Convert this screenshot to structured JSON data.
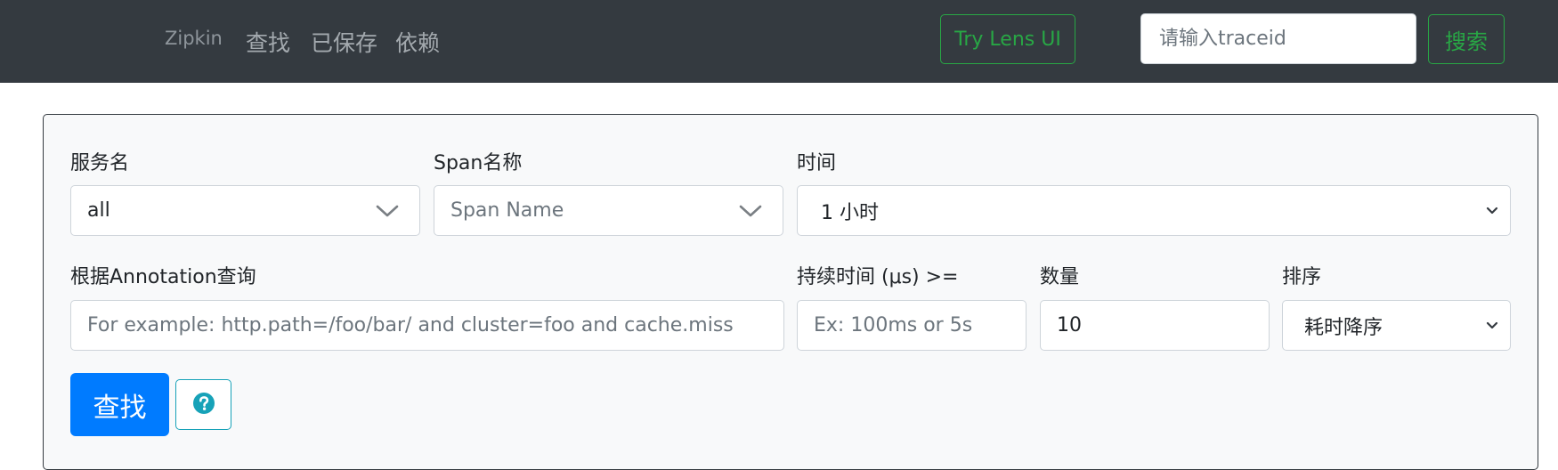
{
  "nav": {
    "brand": "Zipkin",
    "links": [
      "查找",
      "已保存",
      "依赖"
    ],
    "lens_button": "Try Lens UI",
    "trace_placeholder": "请输入traceid",
    "search_button": "搜索"
  },
  "form": {
    "service": {
      "label": "服务名",
      "value": "all"
    },
    "span": {
      "label": "Span名称",
      "placeholder": "Span Name"
    },
    "time": {
      "label": "时间",
      "value": "1 小时"
    },
    "annotation": {
      "label": "根据Annotation查询",
      "placeholder": "For example: http.path=/foo/bar/ and cluster=foo and cache.miss"
    },
    "duration": {
      "label": "持续时间 (μs) >=",
      "placeholder": "Ex: 100ms or 5s"
    },
    "limit": {
      "label": "数量",
      "value": "10"
    },
    "sort": {
      "label": "排序",
      "value": "耗时降序"
    },
    "find_button": "查找",
    "help_icon": "question-circle-icon"
  },
  "colors": {
    "navbar_bg": "#343a40",
    "accent_green": "#28a745",
    "primary_blue": "#007bff",
    "info_teal": "#17a2b8"
  }
}
